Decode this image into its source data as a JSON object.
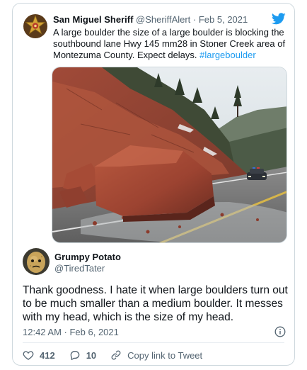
{
  "quoted_tweet": {
    "display_name": "San Miguel Sheriff",
    "handle": "@SheriffAlert",
    "separator": " · ",
    "date": "Feb 5, 2021",
    "text": "A large boulder the size of a large boulder is blocking the southbound lane Hwy 145 mm28 in Stoner Creek area of Montezuma County. Expect delays. ",
    "hashtag": "#largeboulder",
    "avatar_icon": "sheriff-star-badge-icon",
    "platform_icon": "twitter-bird-icon",
    "image_subject": "photo"
  },
  "reply": {
    "display_name": "Grumpy Potato",
    "handle": "@TiredTater",
    "avatar_icon": "potato-avatar",
    "text": "Thank goodness. I hate it when large boulders turn out to be much smaller than a medium boulder. It messes with my head, which is the size of my head.",
    "timestamp": "12:42 AM · Feb 6, 2021",
    "info_icon": "info-icon"
  },
  "actions": {
    "like_count": "412",
    "reply_count": "10",
    "copy_label": "Copy link to Tweet",
    "like_icon": "heart-icon",
    "reply_icon": "comment-icon",
    "copy_icon": "link-icon"
  },
  "colors": {
    "accent": "#1d9bf0",
    "text_primary": "#0f1419",
    "text_secondary": "#536471",
    "border": "#cfd9de"
  }
}
